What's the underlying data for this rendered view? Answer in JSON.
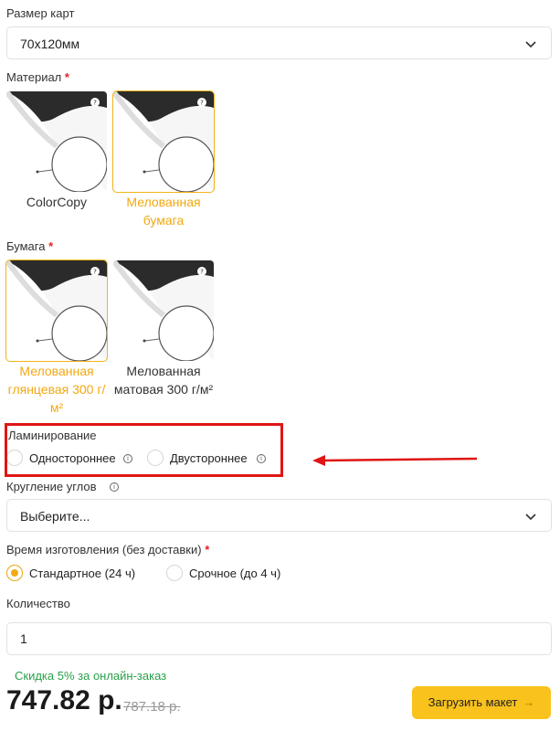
{
  "card_size": {
    "label": "Размер карт",
    "value": "70х120мм"
  },
  "material": {
    "label": "Материал",
    "required_mark": "*",
    "options": [
      {
        "caption": "ColorCopy",
        "brand": "COLORCOPY",
        "selected": false
      },
      {
        "caption": "Мелованная бумага",
        "brand": "МЕЛОВАННАЯ",
        "selected": true
      }
    ]
  },
  "paper": {
    "label": "Бумага",
    "required_mark": "*",
    "options": [
      {
        "caption": "Мелованная глянцевая 300 г/м²",
        "brand": "МЕЛОВАННАЯ ГЛЯНЦЕВАЯ",
        "selected": true
      },
      {
        "caption": "Мелованная матовая 300 г/м²",
        "brand": "МЕЛОВАННАЯ МАТОВАЯ",
        "selected": false
      }
    ]
  },
  "lamination": {
    "label": "Ламинирование",
    "options": [
      {
        "label": "Одностороннее",
        "selected": false
      },
      {
        "label": "Двустороннее",
        "selected": false
      }
    ]
  },
  "rounding": {
    "label": "Кругление углов",
    "placeholder": "Выберите..."
  },
  "production_time": {
    "label": "Время изготовления (без доставки)",
    "required_mark": "*",
    "options": [
      {
        "label": "Стандартное (24 ч)",
        "selected": true
      },
      {
        "label": "Срочное (до 4 ч)",
        "selected": false
      }
    ]
  },
  "quantity": {
    "label": "Количество",
    "value": "1"
  },
  "discount_text": "Скидка 5% за онлайн-заказ",
  "price": "747.82 р.",
  "old_price": "787.18 р.",
  "upload_button": {
    "label": "Загрузить макет",
    "arrow": "→"
  },
  "colors": {
    "accent": "#f2b416",
    "highlight": "#e01515",
    "discount": "#2aa14a"
  }
}
